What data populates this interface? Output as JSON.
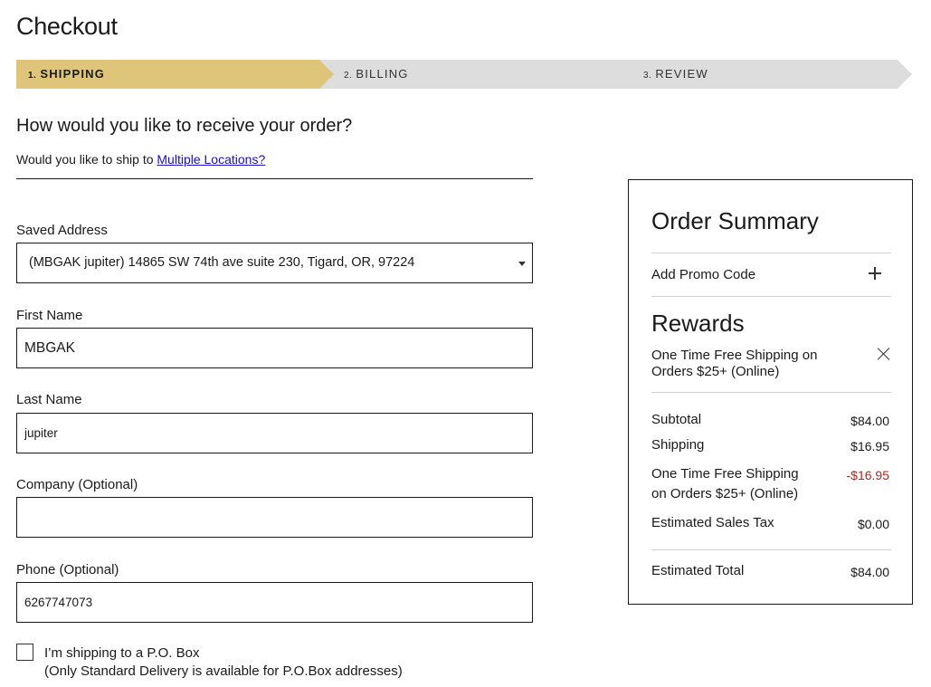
{
  "header": {
    "title": "Checkout"
  },
  "steps": [
    {
      "num": "1.",
      "label": "SHIPPING",
      "state": "active"
    },
    {
      "num": "2.",
      "label": "BILLING",
      "state": "inactive"
    },
    {
      "num": "3.",
      "label": "REVIEW",
      "state": "inactive"
    }
  ],
  "colors": {
    "active_step": "#dec57a",
    "inactive_step": "#dddddd",
    "discount": "#b0261b",
    "link": "#1a0dcc"
  },
  "shipping": {
    "question": "How would you like to receive your order?",
    "multi_prefix": "Would you like to ship to ",
    "multi_link": "Multiple Locations?",
    "saved_address": {
      "label": "Saved Address",
      "value": "(MBGAK jupiter) 14865 SW 74th ave suite 230, Tigard, OR, 97224"
    },
    "first_name": {
      "label": "First Name",
      "value": "MBGAK"
    },
    "last_name": {
      "label": "Last Name",
      "value": "jupiter"
    },
    "company": {
      "label": "Company (Optional)",
      "value": ""
    },
    "phone": {
      "label": "Phone (Optional)",
      "value": "6267747073"
    },
    "pobox": {
      "checked": false,
      "label": "I’m shipping to a P.O. Box",
      "note": "(Only Standard Delivery is available for P.O.Box addresses)"
    }
  },
  "summary": {
    "title": "Order Summary",
    "promo_label": "Add Promo Code",
    "promo_icon": "plus-icon",
    "rewards_title": "Rewards",
    "reward_text": "One Time Free Shipping on Orders $25+ (Online)",
    "reward_icon": "close-icon",
    "subtotal": {
      "label": "Subtotal",
      "value": "$84.00"
    },
    "shipping": {
      "label": "Shipping",
      "value": "$16.95"
    },
    "discount": {
      "label_line1": "One Time Free Shipping",
      "label_line2": "on Orders $25+ (Online)",
      "value": "-$16.95"
    },
    "tax": {
      "label": "Estimated Sales Tax",
      "value": "$0.00"
    },
    "total": {
      "label": "Estimated Total",
      "value": "$84.00"
    }
  }
}
